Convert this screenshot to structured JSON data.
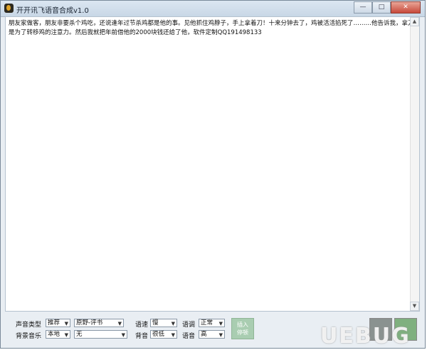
{
  "window": {
    "title": "开开讯飞语音合成v1.0"
  },
  "buttons": {
    "minimize": "—",
    "maximize": "□",
    "close": "✕"
  },
  "content": {
    "text": "朋友家做客，朋友非要杀个鸡吃，还说逢年过节杀鸡都是他的事。见他抓住鸡脖子，手上拿着刀！十来分钟去了，鸡被活活掐死了………他告诉我，拿刀是为了转移鸡的注意力。然后我就把年前借他的2000块钱还给了他，软件定制QQ191498133"
  },
  "controls": {
    "voice_type_label": "声音类型",
    "voice_type_value": "推荐",
    "voice_name_value": "原野-评书",
    "speed_label": "语速",
    "speed_value": "慢",
    "tone_label": "语调",
    "tone_value": "正常",
    "bg_music_label": "背景音乐",
    "bg_music_value": "本地",
    "bg_music_file": "无",
    "bg_label": "背音",
    "bg_value": "很低",
    "volume_label": "语音",
    "volume_value": "高",
    "insert_pause_label": "插入\n停顿"
  },
  "colors": {
    "insert_button": "#a9cdb1",
    "play_button": "#8a9290",
    "save_button": "#7fb07f"
  },
  "watermark": "UEBUG"
}
